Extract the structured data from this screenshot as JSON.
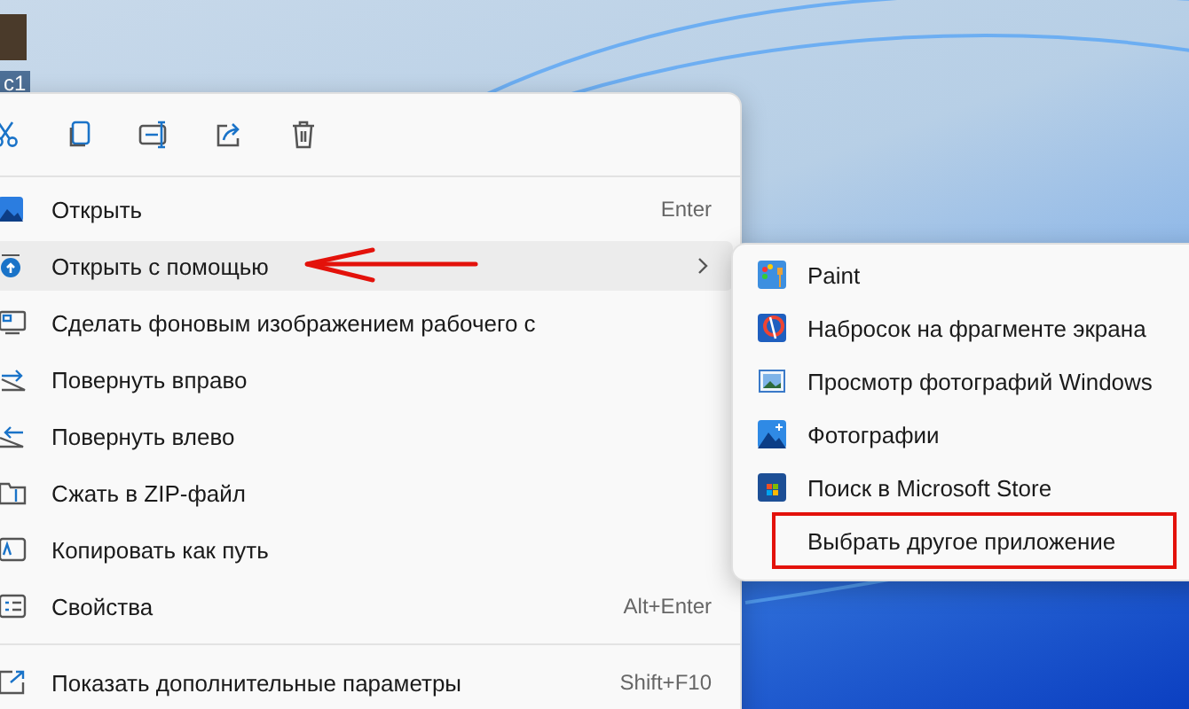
{
  "desktop_icon": {
    "label": "c1"
  },
  "toolbar": [
    {
      "kind": "cut"
    },
    {
      "kind": "copy"
    },
    {
      "kind": "rename"
    },
    {
      "kind": "share"
    },
    {
      "kind": "delete"
    }
  ],
  "menu_items": [
    {
      "label": "Открыть",
      "shortcut": "Enter",
      "submenu": false,
      "selected": false,
      "annotated": false
    },
    {
      "label": "Открыть с помощью",
      "submenu": true,
      "selected": true,
      "annotated": true
    },
    {
      "label": "Сделать фоновым изображением рабочего с",
      "submenu": false,
      "selected": false,
      "annotated": false
    },
    {
      "label": "Повернуть вправо",
      "submenu": false,
      "selected": false,
      "annotated": false
    },
    {
      "label": "Повернуть влево",
      "submenu": false,
      "selected": false,
      "annotated": false
    },
    {
      "label": "Сжать в ZIP-файл",
      "submenu": false,
      "selected": false,
      "annotated": false
    },
    {
      "label": "Копировать как путь",
      "submenu": false,
      "selected": false,
      "annotated": false
    },
    {
      "label": "Свойства",
      "shortcut": "Alt+Enter",
      "submenu": false,
      "selected": false,
      "annotated": false
    }
  ],
  "more_options": {
    "label": "Показать дополнительные параметры",
    "shortcut": "Shift+F10"
  },
  "submenu_items": [
    {
      "label": "Paint",
      "outlined": false
    },
    {
      "label": "Набросок на фрагменте экрана",
      "outlined": false
    },
    {
      "label": "Просмотр фотографий Windows",
      "outlined": false
    },
    {
      "label": "Фотографии",
      "outlined": false
    },
    {
      "label": "Поиск в Microsoft Store",
      "outlined": false
    },
    {
      "label": "Выбрать другое приложение",
      "outlined": true
    }
  ]
}
